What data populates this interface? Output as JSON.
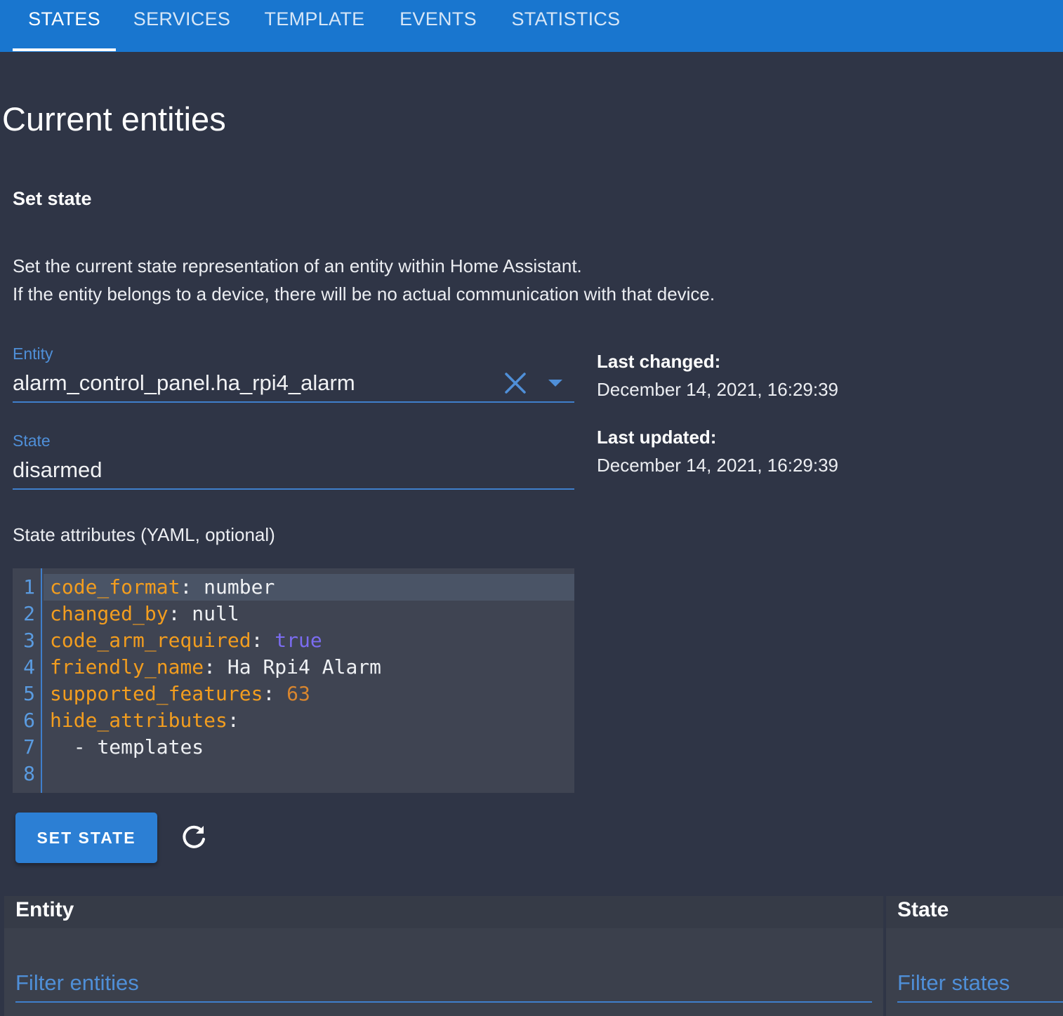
{
  "tabs": [
    {
      "label": "STATES",
      "active": true
    },
    {
      "label": "SERVICES"
    },
    {
      "label": "TEMPLATE"
    },
    {
      "label": "EVENTS"
    },
    {
      "label": "STATISTICS"
    }
  ],
  "page_title": "Current entities",
  "set_state": {
    "title": "Set state",
    "description_line1": "Set the current state representation of an entity within Home Assistant.",
    "description_line2": "If the entity belongs to a device, there will be no actual communication with that device.",
    "entity_label": "Entity",
    "entity_value": "alarm_control_panel.ha_rpi4_alarm",
    "state_label": "State",
    "state_value": "disarmed",
    "attributes_label": "State attributes (YAML, optional)",
    "last_changed_label": "Last changed:",
    "last_changed_value": "December 14, 2021, 16:29:39",
    "last_updated_label": "Last updated:",
    "last_updated_value": "December 14, 2021, 16:29:39",
    "button_label": "SET STATE"
  },
  "yaml_lines": [
    {
      "num": "1",
      "key": "code_format",
      "sep": ": ",
      "value": "number",
      "vtype": "plain"
    },
    {
      "num": "2",
      "key": "changed_by",
      "sep": ": ",
      "value": "null",
      "vtype": "plain"
    },
    {
      "num": "3",
      "key": "code_arm_required",
      "sep": ": ",
      "value": "true",
      "vtype": "bool"
    },
    {
      "num": "4",
      "key": "friendly_name",
      "sep": ": ",
      "value": "Ha Rpi4 Alarm",
      "vtype": "plain"
    },
    {
      "num": "5",
      "key": "supported_features",
      "sep": ": ",
      "value": "63",
      "vtype": "num"
    },
    {
      "num": "6",
      "key": "hide_attributes",
      "sep": ":",
      "value": "",
      "vtype": "plain"
    },
    {
      "num": "7",
      "key": "",
      "sep": "  - ",
      "value": "templates",
      "vtype": "plain"
    },
    {
      "num": "8",
      "key": "",
      "sep": "",
      "value": "",
      "vtype": "plain"
    }
  ],
  "table": {
    "entity_header": "Entity",
    "state_header": "State",
    "filter_entities_placeholder": "Filter entities",
    "filter_states_placeholder": "Filter states"
  },
  "icons": {
    "clear": "close-icon",
    "dropdown": "menu-down-icon",
    "refresh": "refresh-icon"
  },
  "colors": {
    "header": "#1976cf",
    "background": "#2f3546",
    "accent": "#3f7fcc",
    "yaml_key": "#f29d1f",
    "yaml_bool": "#7b6cf0",
    "yaml_number": "#d9862e"
  }
}
